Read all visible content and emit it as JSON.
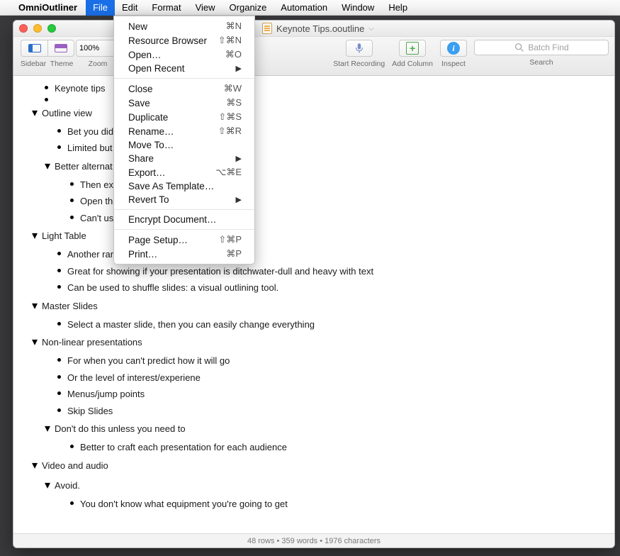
{
  "menubar": {
    "app": "OmniOutliner",
    "items": [
      "File",
      "Edit",
      "Format",
      "View",
      "Organize",
      "Automation",
      "Window",
      "Help"
    ]
  },
  "dropdown": {
    "groups": [
      [
        {
          "label": "New",
          "shortcut": "⌘N"
        },
        {
          "label": "Resource Browser",
          "shortcut": "⇧⌘N"
        },
        {
          "label": "Open…",
          "shortcut": "⌘O"
        },
        {
          "label": "Open Recent",
          "sub": true
        }
      ],
      [
        {
          "label": "Close",
          "shortcut": "⌘W"
        },
        {
          "label": "Save",
          "shortcut": "⌘S"
        },
        {
          "label": "Duplicate",
          "shortcut": "⇧⌘S"
        },
        {
          "label": "Rename…",
          "shortcut": "⇧⌘R"
        },
        {
          "label": "Move To…"
        },
        {
          "label": "Share",
          "sub": true
        },
        {
          "label": "Export…",
          "shortcut": "⌥⌘E"
        },
        {
          "label": "Save As Template…"
        },
        {
          "label": "Revert To",
          "sub": true
        }
      ],
      [
        {
          "label": "Encrypt Document…"
        }
      ],
      [
        {
          "label": "Page Setup…",
          "shortcut": "⇧⌘P"
        },
        {
          "label": "Print…",
          "shortcut": "⌘P"
        }
      ]
    ]
  },
  "window": {
    "title": "Keynote Tips.ooutline",
    "toolbar": {
      "sidebar": "Sidebar",
      "theme": "Theme",
      "zoom": "Zoom",
      "zoom_value": "100%",
      "start_recording": "Start Recording",
      "add_column": "Add Column",
      "inspect": "Inspect",
      "search": "Search",
      "search_placeholder": "Batch Find"
    },
    "status": "48 rows • 359 words • 1976 characters"
  },
  "outline": [
    {
      "lvl": "0b",
      "text": "Keynote tips"
    },
    {
      "lvl": "0b",
      "text": ""
    },
    {
      "lvl": "0",
      "disc": "down",
      "text": "Outline view"
    },
    {
      "lvl": "1b",
      "text": "Bet you didn't"
    },
    {
      "lvl": "1b",
      "text": "Limited but us"
    },
    {
      "lvl": "1",
      "disc": "down",
      "text": "Better alternat"
    },
    {
      "lvl": "2b",
      "text": "Then expor"
    },
    {
      "lvl": "2b",
      "text": "Open the P"
    },
    {
      "lvl": "2b",
      "text": "Can't use O                                         n't recognise it"
    },
    {
      "lvl": "0",
      "disc": "down",
      "text": "Light Table"
    },
    {
      "lvl": "1b",
      "text": "Another rarely-used view"
    },
    {
      "lvl": "1b",
      "text": "Great for showing if your presentation is ditchwater-dull and heavy with text"
    },
    {
      "lvl": "1b",
      "text": "Can be used to shuffle slides: a visual outlining tool."
    },
    {
      "lvl": "0",
      "disc": "down",
      "text": "Master Slides"
    },
    {
      "lvl": "1b",
      "text": "Select a master slide, then you can easily change everything"
    },
    {
      "lvl": "0",
      "disc": "down",
      "text": "Non-linear presentations"
    },
    {
      "lvl": "1b",
      "text": "For when you can't predict how it will go"
    },
    {
      "lvl": "1b",
      "text": "Or the level of interest/experiene"
    },
    {
      "lvl": "1b",
      "text": "Menus/jump points"
    },
    {
      "lvl": "1b",
      "text": "Skip Slides"
    },
    {
      "lvl": "1",
      "disc": "down",
      "text": "Don't do this unless you need to"
    },
    {
      "lvl": "2b",
      "text": "Better to craft each presentation for each audience"
    },
    {
      "lvl": "0",
      "disc": "down",
      "text": "Video and audio"
    },
    {
      "lvl": "1",
      "disc": "down",
      "text": "Avoid."
    },
    {
      "lvl": "2b",
      "text": "You don't know what equipment you're going to get"
    }
  ]
}
